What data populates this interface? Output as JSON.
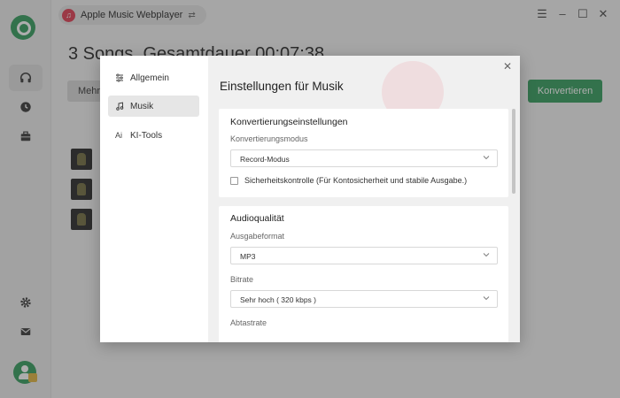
{
  "app": {
    "source_name": "Apple Music Webplayer",
    "page_title": "3 Songs, Gesamtdauer 00:07:38",
    "more_label": "Mehr",
    "convert_label": "Konvertieren"
  },
  "settings": {
    "title": "Einstellungen für Musik",
    "nav": [
      {
        "label": "Allgemein",
        "icon": "sliders-icon"
      },
      {
        "label": "Musik",
        "icon": "music-note-icon",
        "selected": true
      },
      {
        "label": "KI-Tools",
        "icon": "ai-icon"
      }
    ],
    "conversion": {
      "heading": "Konvertierungseinstellungen",
      "mode_label": "Konvertierungsmodus",
      "mode_value": "Record-Modus",
      "safety_check_label": "Sicherheitskontrolle (Für Kontosicherheit und stabile Ausgabe.)",
      "safety_check_checked": false
    },
    "audio": {
      "heading": "Audioqualität",
      "format_label": "Ausgabeformat",
      "format_value": "MP3",
      "bitrate_label": "Bitrate",
      "bitrate_value": "Sehr hoch ( 320 kbps )",
      "samplerate_label": "Abtastrate"
    }
  },
  "colors": {
    "accent": "#2e9a58",
    "overlay": "rgba(60,60,60,0.42)"
  }
}
